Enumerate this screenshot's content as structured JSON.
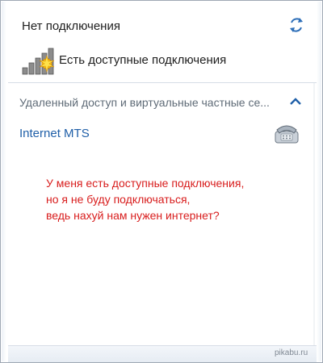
{
  "panel": {
    "title": "Нет подключения",
    "status_text": "Есть доступные подключения",
    "section_header": "Удаленный доступ и виртуальные частные се...",
    "connection_name": "Internet MTS"
  },
  "annotation": {
    "lines": [
      "У меня есть доступные подключения,",
      "но я не буду подключаться,",
      "ведь нахуй нам нужен интернет?"
    ]
  },
  "watermark": "pikabu.ru",
  "colors": {
    "link": "#1f5fa8",
    "annotation": "#d81c1c",
    "section_text": "#5f6b77"
  },
  "icons": {
    "refresh": "refresh-arrows-icon",
    "signal": "wireless-signal-available-icon",
    "collapse": "chevron-up-icon",
    "connection": "dialup-modem-phone-icon"
  }
}
